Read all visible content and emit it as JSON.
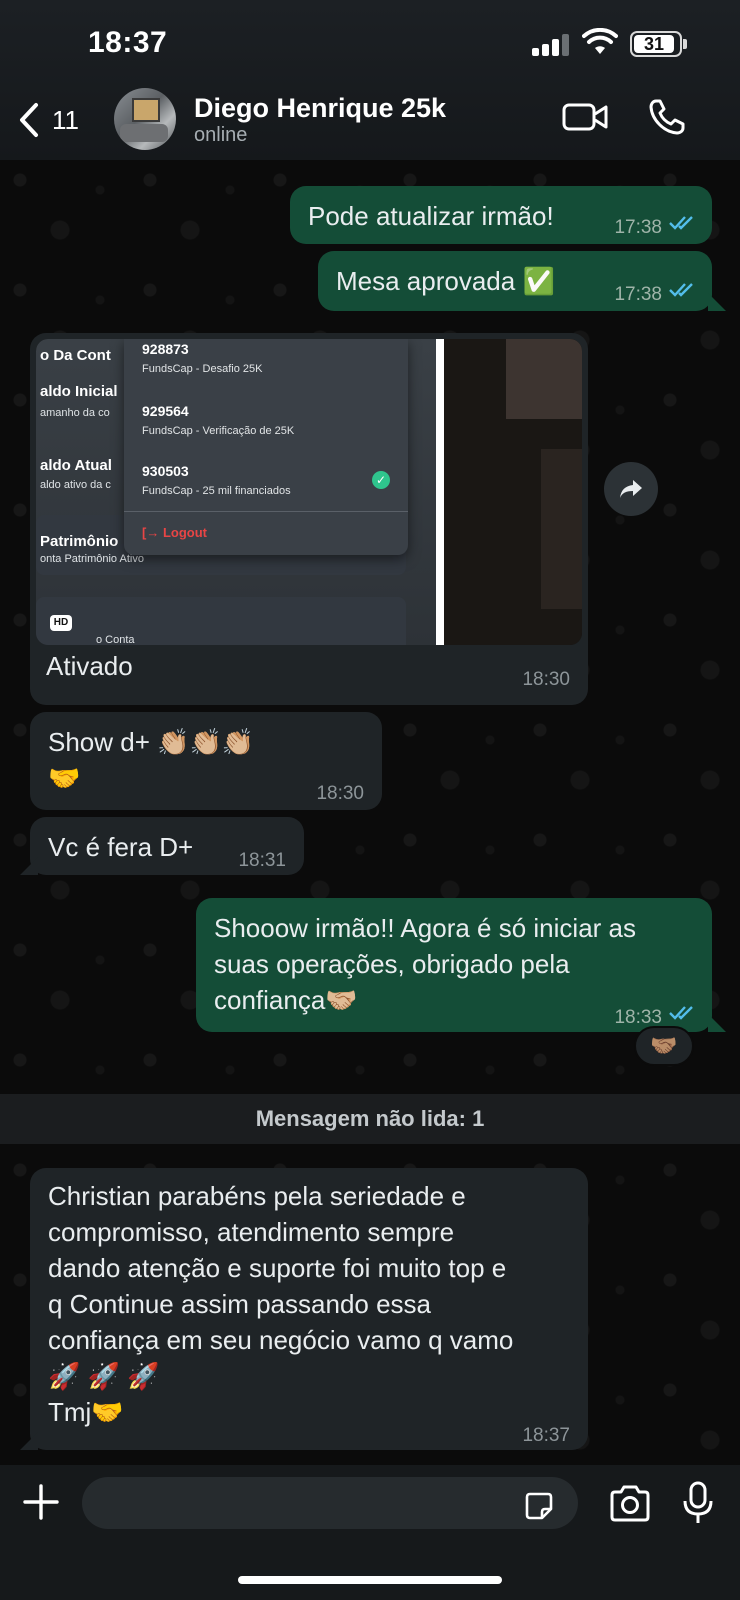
{
  "status_bar": {
    "time": "18:37",
    "battery": "31"
  },
  "header": {
    "back_count": "11",
    "contact_name": "Diego Henrique 25k",
    "contact_status": "online"
  },
  "messages": [
    {
      "direction": "out",
      "text": "Pode atualizar irmão!",
      "time": "17:38",
      "read": true
    },
    {
      "direction": "out",
      "text": "Mesa aprovada ✅",
      "time": "17:38",
      "read": true
    },
    {
      "direction": "in",
      "type": "image",
      "caption": "Ativado",
      "time": "18:30",
      "hd": "HD",
      "screenshot": {
        "left_labels": [
          "o Da Cont",
          "aldo Inicial",
          "amanho da co",
          "aldo Atual",
          "aldo ativo da c",
          "Patrimônio",
          "onta Patrimônio Ativo",
          "o Conta"
        ],
        "accounts": [
          {
            "id": "928873",
            "name": "FundsCap - Desafio 25K"
          },
          {
            "id": "929564",
            "name": "FundsCap - Verificação de 25K"
          },
          {
            "id": "930503",
            "name": "FundsCap - 25 mil financiados"
          }
        ],
        "logout": "Logout"
      }
    },
    {
      "direction": "in",
      "text": "Show d+ 👏🏼👏🏼👏🏼",
      "text2": "🤝",
      "time": "18:30"
    },
    {
      "direction": "in",
      "text": "Vc é fera D+",
      "time": "18:31"
    },
    {
      "direction": "out",
      "lines": [
        "Shooow irmão!! Agora é só iniciar as",
        "suas operações, obrigado pela",
        "confiança🤝🏼"
      ],
      "time": "18:33",
      "read": true,
      "reaction": "🤝🏽"
    },
    {
      "direction": "in",
      "lines": [
        "Christian parabéns pela seriedade e",
        "compromisso, atendimento sempre",
        "dando atenção e suporte foi muito top e",
        "q Continue assim passando essa",
        "confiança em seu negócio vamo q vamo",
        "🚀 🚀 🚀",
        "Tmj🤝"
      ],
      "time": "18:37"
    }
  ],
  "unread_banner": "Mensagem não lida: 1",
  "input": {
    "placeholder": ""
  },
  "icons": {
    "back": "chevron-left-icon",
    "video": "video-call-icon",
    "call": "phone-icon",
    "forward": "forward-icon",
    "plus": "plus-icon",
    "sticker": "sticker-icon",
    "camera": "camera-icon",
    "mic": "microphone-icon"
  },
  "colors": {
    "outgoing_bubble": "#144d37",
    "incoming_bubble": "#1f2427",
    "read_ticks": "#53bdeb",
    "background": "#0b0b0b"
  }
}
